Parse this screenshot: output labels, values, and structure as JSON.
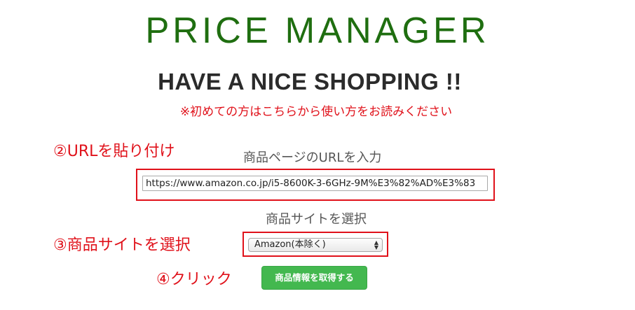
{
  "app": {
    "title": "PRICE MANAGER",
    "subtitle": "HAVE A NICE SHOPPING !!",
    "help_link": "※初めての方はこちらから使い方をお読みください"
  },
  "url_section": {
    "annotation": "②URLを貼り付け",
    "label": "商品ページのURLを入力",
    "input_value": "https://www.amazon.co.jp/i5-8600K-3-6GHz-9M%E3%82%AD%E3%83"
  },
  "site_section": {
    "annotation": "③商品サイトを選択",
    "label": "商品サイトを選択",
    "selected_option": "Amazon(本除く)"
  },
  "submit_section": {
    "annotation": "④クリック",
    "button_label": "商品情報を取得する"
  },
  "colors": {
    "title_green": "#1f6e10",
    "annotation_red": "#e0111a",
    "button_green": "#43b84f"
  }
}
